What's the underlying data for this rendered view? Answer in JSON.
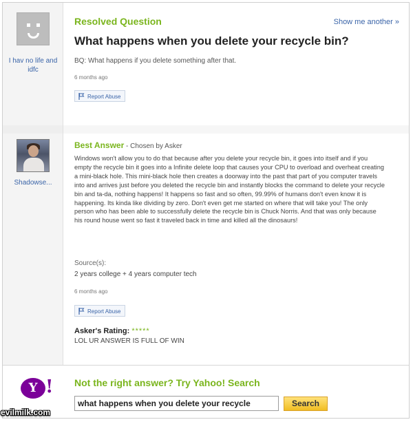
{
  "question": {
    "asker_name": "I hav no life and idfc",
    "label": "Resolved Question",
    "show_another": "Show me another »",
    "title": "What happens when you delete your recycle bin?",
    "details": "BQ: What happens if you delete something after that.",
    "time": "6 months ago",
    "report_label": "Report Abuse"
  },
  "answer": {
    "answerer_name": "Shadowse...",
    "label": "Best Answer",
    "chosen_by": " - Chosen by Asker",
    "body": "Windows won't allow you to do that because after you delete your recycle bin, it goes into itself and if you empty the recycle bin it goes into a Infinite delete loop that causes your CPU to overload and overheat creating a mini-black hole. This mini-black hole then creates a doorway into the past that part of you computer travels into and arrives just before you deleted the recycle bin and instantly blocks the command to delete your recycle bin and ta-da, nothing happens! It happens so fast and so often, 99.99% of humans don't even know it is happening. Its kinda like dividing by zero. Don't even get me started on where that will take you! The only person who has been able to successfully delete the recycle bin is Chuck Norris. And that was only because his round house went so fast it traveled back in time and killed all the dinosaurs!",
    "sources_label": "Source(s):",
    "sources": "2 years college + 4 years computer tech",
    "time": "6 months ago",
    "report_label": "Report Abuse",
    "rating_label": "Asker's Rating:",
    "rating_stars": "*****",
    "rating_value": 5,
    "rating_comment": "LOL UR ANSWER IS FULL OF WIN"
  },
  "search": {
    "prompt": "Not the right answer? Try Yahoo! Search",
    "query": "what happens when you delete your recycle",
    "button": "Search",
    "logo_text": "Y",
    "logo_bang": "!"
  },
  "watermark": "evilmilk.com",
  "colors": {
    "accent_green": "#7ab51d",
    "link_blue": "#3a64a8",
    "yahoo_purple": "#7b0099",
    "search_button": "#f1bd22"
  }
}
